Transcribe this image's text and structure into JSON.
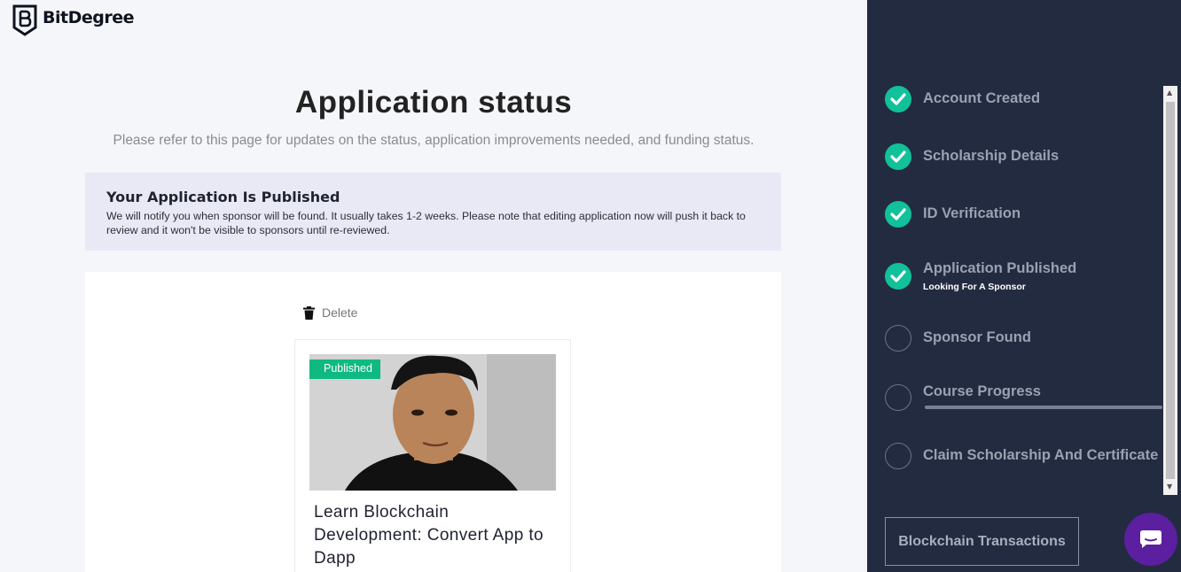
{
  "brand": {
    "name": "BitDegree",
    "icon": "bitdegree-shield-logo"
  },
  "header": {
    "title": "Application status",
    "subtitle": "Please refer to this page for updates on the status, application improvements needed, and funding status."
  },
  "notice": {
    "title": "Your Application Is Published",
    "text": "We will notify you when sponsor will be found. It usually takes 1-2 weeks. Please note that editing application now will push it back to review and it won't be visible to sponsors until re-reviewed."
  },
  "course_card": {
    "delete_label": "Delete",
    "delete_icon": "trash-icon",
    "badge": "Published",
    "title": "Learn Blockchain Development: Convert App to Dapp"
  },
  "steps": [
    {
      "label": "Account Created",
      "done": true
    },
    {
      "label": "Scholarship Details",
      "done": true
    },
    {
      "label": "ID Verification",
      "done": true
    },
    {
      "label": "Application Published",
      "sub": "Looking For A Sponsor",
      "done": true
    },
    {
      "label": "Sponsor Found",
      "done": false
    },
    {
      "label": "Course Progress",
      "done": false,
      "progress": 0
    },
    {
      "label": "Claim Scholarship And Certificate",
      "done": false
    }
  ],
  "sidebar": {
    "tx_button": "Blockchain Transactions",
    "chat_icon": "chat-bubble-icon"
  },
  "colors": {
    "accent_green": "#10c19a",
    "badge_green": "#10b981",
    "sidebar_bg": "#232b40",
    "chat_purple": "#5b1fa0"
  }
}
